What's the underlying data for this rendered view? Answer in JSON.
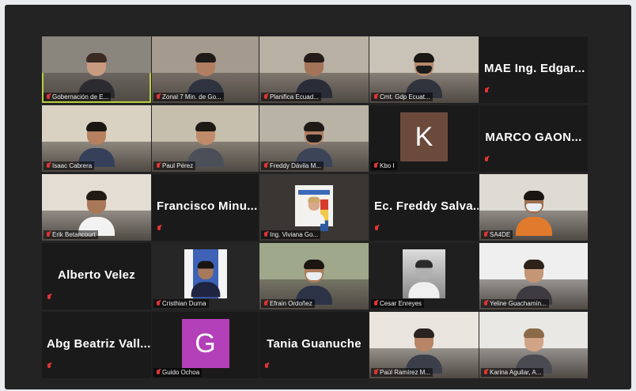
{
  "meeting": {
    "tiles": [
      {
        "kind": "video",
        "name": "Gobernación de E...",
        "active": true,
        "skin": "#c89a80",
        "hair": "#3a2a22",
        "body": "#2b2b30",
        "mask": "none",
        "bg": "#8a857d"
      },
      {
        "kind": "video",
        "name": "Zonal 7 Min. de Go...",
        "skin": "#b27e62",
        "hair": "#1e1a18",
        "body": "#2f3340",
        "mask": "none",
        "bg": "#a49a8e"
      },
      {
        "kind": "video",
        "name": "Planifica Ecuad...",
        "skin": "#a47458",
        "hair": "#241c18",
        "body": "#2a2c38",
        "mask": "none",
        "bg": "#b8b0a2"
      },
      {
        "kind": "video",
        "name": "Cmt. Gdp Ecuat...",
        "skin": "#b8896c",
        "hair": "#1b1714",
        "body": "#30323c",
        "mask": "dark",
        "bg": "#c9c2b6"
      },
      {
        "kind": "name",
        "name": "MAE Ing. Edgar..."
      },
      {
        "kind": "video",
        "name": "Isaac Cabrera",
        "skin": "#b5805f",
        "hair": "#1b1612",
        "body": "#36405a",
        "mask": "none",
        "bg": "#d9d2c3"
      },
      {
        "kind": "video",
        "name": "Paul Pérez",
        "skin": "#c08b6a",
        "hair": "#1d1915",
        "body": "#4b4f58",
        "mask": "none",
        "bg": "#c7bfae"
      },
      {
        "kind": "video",
        "name": "Freddy Dávila M...",
        "skin": "#b07d60",
        "hair": "#201a16",
        "body": "#3c4458",
        "mask": "dark",
        "bg": "#b9b3a6"
      },
      {
        "kind": "avatar",
        "name": "Kbo I",
        "letter": "K",
        "color": "#6b4a3c"
      },
      {
        "kind": "name",
        "name": "MARCO GAON..."
      },
      {
        "kind": "video",
        "name": "Erik Betancourt",
        "skin": "#a87858",
        "hair": "#211914",
        "body": "#f2f2f2",
        "mask": "none",
        "bg": "#e4ddd4"
      },
      {
        "kind": "name",
        "name": "Francisco Minu..."
      },
      {
        "kind": "poster",
        "name": "Ing. Viviana Go..."
      },
      {
        "kind": "name",
        "name": "Ec. Freddy Salva..."
      },
      {
        "kind": "video",
        "name": "SA4DE",
        "skin": "#9d6f52",
        "hair": "#1a1512",
        "body": "#e07a2c",
        "mask": "light",
        "bg": "#dedad4"
      },
      {
        "kind": "name",
        "name": "Alberto Velez"
      },
      {
        "kind": "portrait",
        "name": "Cristhian Durna"
      },
      {
        "kind": "video",
        "name": "Efrain Ordoñez",
        "skin": "#ae7c5c",
        "hair": "#1c1612",
        "body": "#2d3347",
        "mask": "light",
        "bg": "#9fa88b"
      },
      {
        "kind": "bwphoto",
        "name": "Cesar Enreyes"
      },
      {
        "kind": "video",
        "name": "Yeline Guachamín...",
        "skin": "#c49676",
        "hair": "#2e2119",
        "body": "#3d3a40",
        "mask": "none",
        "bg": "#efefef"
      },
      {
        "kind": "name",
        "name": "Abg Beatriz Vall..."
      },
      {
        "kind": "avatar",
        "name": "Guido Ochoa",
        "letter": "G",
        "color": "#b340b8"
      },
      {
        "kind": "name",
        "name": "Tania Guanuche"
      },
      {
        "kind": "video",
        "name": "Paúl Ramírez M...",
        "skin": "#b88566",
        "hair": "#2a231f",
        "body": "#3b3f4a",
        "mask": "none",
        "bg": "#eae6df"
      },
      {
        "kind": "video",
        "name": "Karina Aguilar, A...",
        "skin": "#d2a487",
        "hair": "#8a6a48",
        "body": "#4a4a52",
        "mask": "none",
        "bg": "#e9e8e4"
      }
    ]
  },
  "colors": {
    "active_border": "#b8cf3c",
    "muted": "#e03434",
    "tile_bg": "#1a1a1a"
  }
}
